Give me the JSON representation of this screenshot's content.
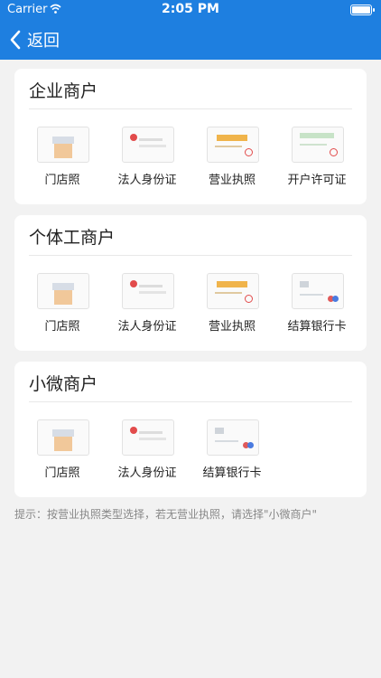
{
  "status_bar": {
    "carrier": "Carrier",
    "time": "2:05 PM"
  },
  "nav": {
    "back_label": "返回"
  },
  "sections": [
    {
      "title": "企业商户",
      "items": [
        {
          "label": "门店照",
          "icon": "storefront-photo-icon"
        },
        {
          "label": "法人身份证",
          "icon": "id-card-icon"
        },
        {
          "label": "营业执照",
          "icon": "business-license-icon"
        },
        {
          "label": "开户许可证",
          "icon": "account-permit-icon"
        }
      ]
    },
    {
      "title": "个体工商户",
      "items": [
        {
          "label": "门店照",
          "icon": "storefront-photo-icon"
        },
        {
          "label": "法人身份证",
          "icon": "id-card-icon"
        },
        {
          "label": "营业执照",
          "icon": "business-license-icon"
        },
        {
          "label": "结算银行卡",
          "icon": "bank-card-icon"
        }
      ]
    },
    {
      "title": "小微商户",
      "items": [
        {
          "label": "门店照",
          "icon": "storefront-photo-icon"
        },
        {
          "label": "法人身份证",
          "icon": "id-card-icon"
        },
        {
          "label": "结算银行卡",
          "icon": "bank-card-icon"
        }
      ]
    }
  ],
  "hint": "提示：按营业执照类型选择，若无营业执照，请选择\"小微商户\"",
  "colors": {
    "nav_bg": "#1e7fe0",
    "page_bg": "#f2f2f2"
  }
}
